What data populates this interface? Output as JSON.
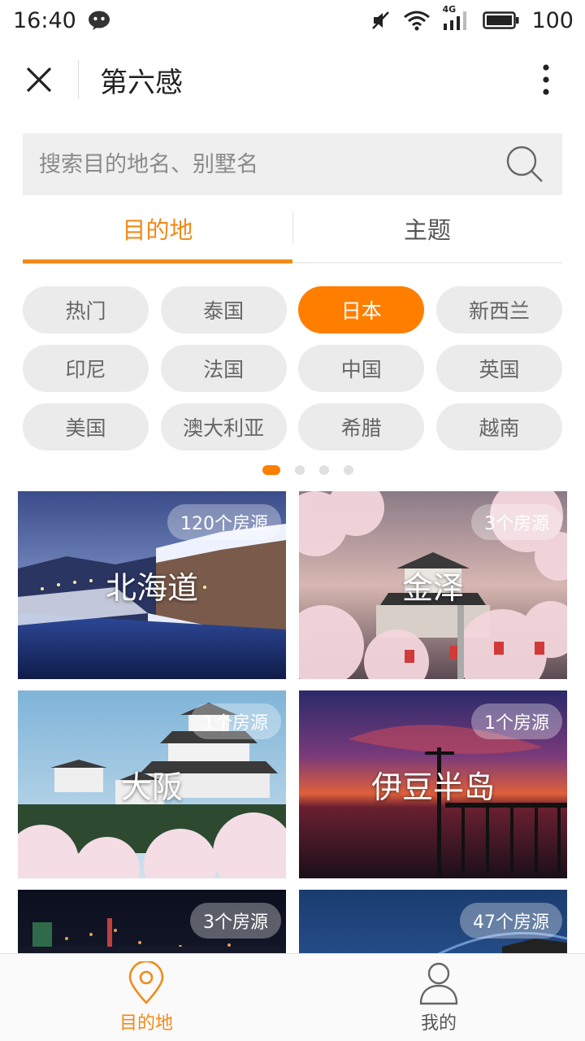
{
  "status_bar": {
    "time": "16:40",
    "network": "4G",
    "battery": "100",
    "icons": [
      "wechat-icon",
      "mute-icon",
      "wifi-icon",
      "signal-icon",
      "battery-icon"
    ]
  },
  "nav": {
    "title": "第六感",
    "icons": [
      "close-icon",
      "more-vertical-icon"
    ]
  },
  "search": {
    "placeholder": "搜索目的地名、别墅名",
    "value": ""
  },
  "tabs": [
    {
      "label": "目的地",
      "active": true
    },
    {
      "label": "主题",
      "active": false
    }
  ],
  "chips": [
    {
      "label": "热门"
    },
    {
      "label": "泰国"
    },
    {
      "label": "日本",
      "selected": true
    },
    {
      "label": "新西兰"
    },
    {
      "label": "印尼"
    },
    {
      "label": "法国"
    },
    {
      "label": "中国"
    },
    {
      "label": "英国"
    },
    {
      "label": "美国"
    },
    {
      "label": "澳大利亚"
    },
    {
      "label": "希腊"
    },
    {
      "label": "越南"
    }
  ],
  "pager": {
    "pages": 4,
    "current": 1
  },
  "destinations": [
    {
      "name": "北海道",
      "count": "120个房源"
    },
    {
      "name": "金泽",
      "count": "3个房源"
    },
    {
      "name": "大阪",
      "count": "1个房源"
    },
    {
      "name": "伊豆半岛",
      "count": "1个房源"
    },
    {
      "name": "",
      "count": "3个房源"
    },
    {
      "name": "",
      "count": "47个房源"
    }
  ],
  "bottom_nav": [
    {
      "label": "目的地",
      "icon": "location-pin-icon",
      "active": true
    },
    {
      "label": "我的",
      "icon": "user-icon",
      "active": false
    }
  ],
  "colors": {
    "accent": "#ff7e00",
    "accent_text": "#f28a19",
    "chip_bg": "#ebebeb",
    "search_bg": "#efefef"
  }
}
